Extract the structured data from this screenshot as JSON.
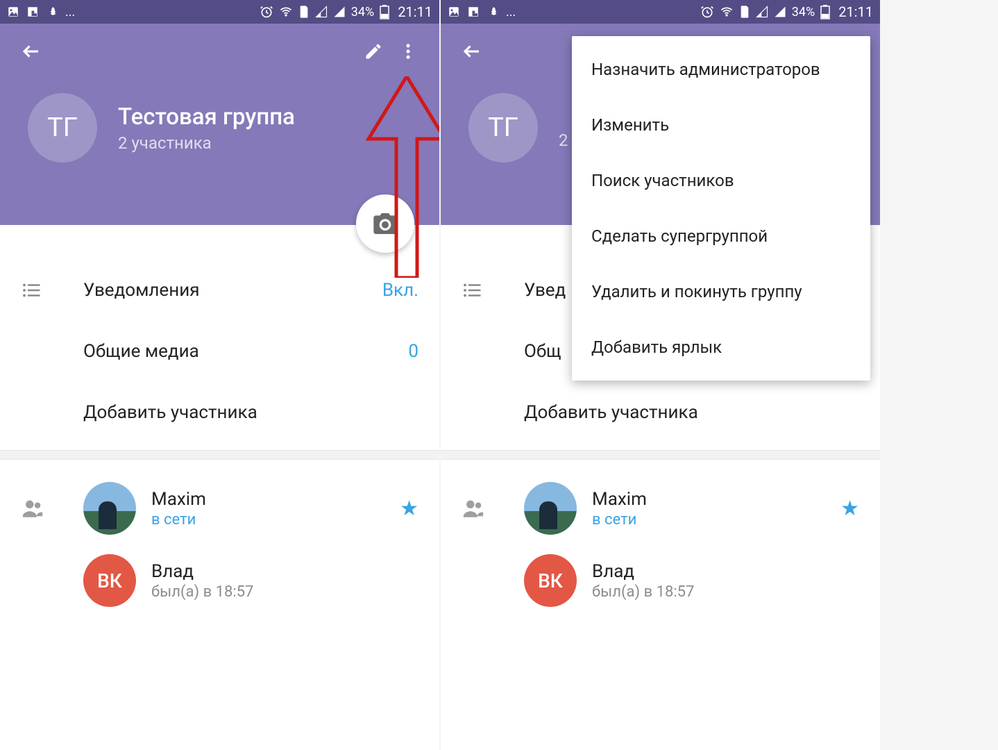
{
  "status": {
    "battery": "34%",
    "time": "21:11",
    "ellipsis": "..."
  },
  "group": {
    "avatar_initials": "ТГ",
    "name": "Тестовая группа",
    "subtitle": "2 участника"
  },
  "rows": {
    "notifications_label": "Уведомления",
    "notifications_value": "Вкл.",
    "media_label": "Общие медиа",
    "media_value": "0",
    "add_member_label": "Добавить участника"
  },
  "members": [
    {
      "name": "Maxim",
      "status": "в сети",
      "avatar_text": "",
      "avatar_class": "avatar-maxim",
      "online": true,
      "starred": true
    },
    {
      "name": "Влад",
      "status": "был(а) в 18:57",
      "avatar_text": "ВК",
      "avatar_class": "avatar-vlad",
      "online": false,
      "starred": false
    }
  ],
  "menu": {
    "items": [
      "Назначить администраторов",
      "Изменить",
      "Поиск участников",
      "Сделать супергруппой",
      "Удалить и покинуть группу",
      "Добавить ярлык"
    ]
  }
}
